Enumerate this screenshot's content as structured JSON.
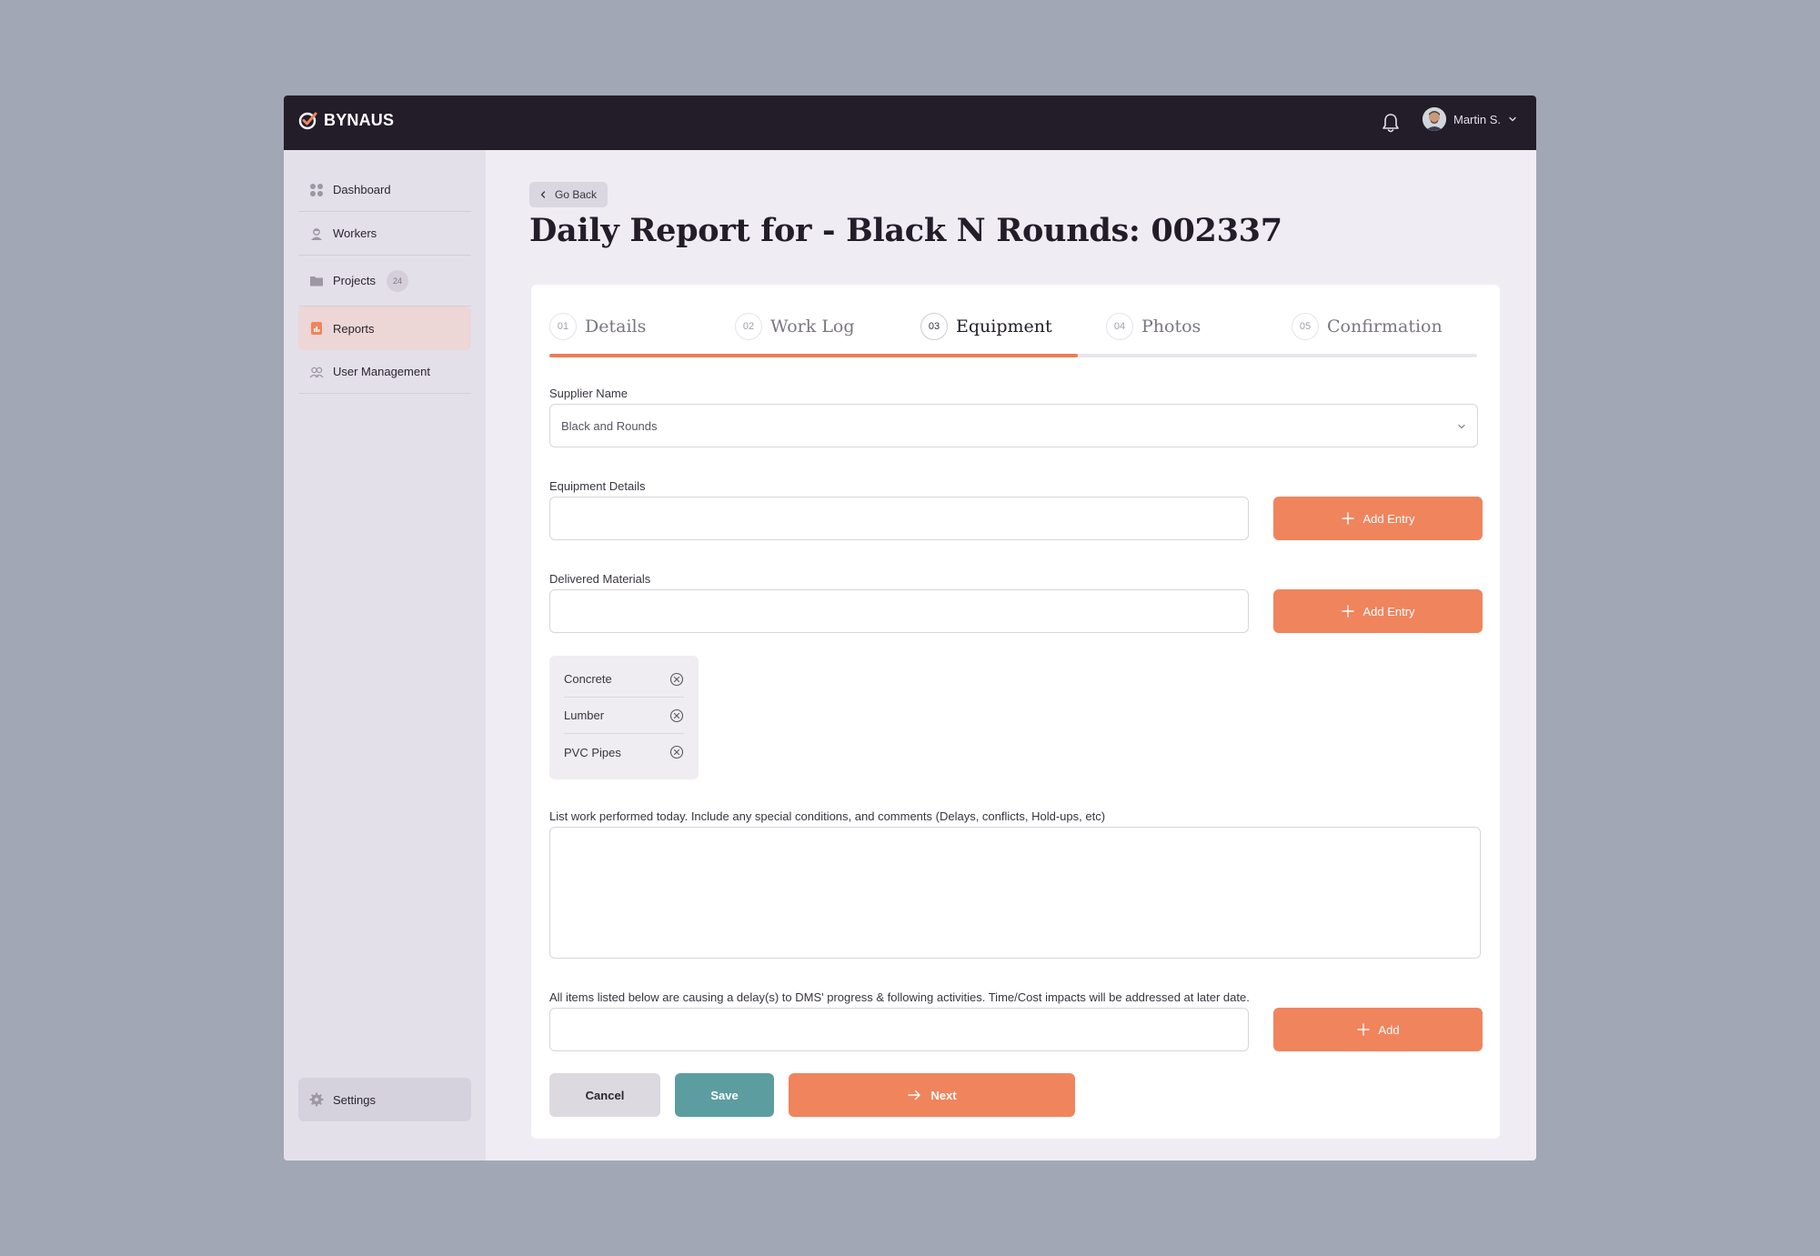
{
  "app": {
    "brand": "BYNAUS",
    "user_name": "Martin S."
  },
  "sidebar": {
    "items": [
      {
        "label": "Dashboard",
        "icon": "grid-icon"
      },
      {
        "label": "Workers",
        "icon": "worker-icon"
      },
      {
        "label": "Projects",
        "icon": "folder-icon",
        "badge": "24"
      },
      {
        "label": "Reports",
        "icon": "report-icon",
        "active": true
      },
      {
        "label": "User Management",
        "icon": "users-icon"
      }
    ],
    "settings_label": "Settings"
  },
  "header": {
    "back_label": "Go Back",
    "title": "Daily Report for - Black N Rounds: 002337"
  },
  "steps": [
    {
      "num": "01",
      "label": "Details"
    },
    {
      "num": "02",
      "label": "Work Log"
    },
    {
      "num": "03",
      "label": "Equipment",
      "active": true
    },
    {
      "num": "04",
      "label": "Photos"
    },
    {
      "num": "05",
      "label": "Confirmation"
    }
  ],
  "progress": 0.57,
  "form": {
    "supplier_label": "Supplier Name",
    "supplier_value": "Black and Rounds",
    "equipment_label": "Equipment Details",
    "equipment_value": "",
    "materials_label": "Delivered Materials",
    "materials_value": "",
    "add_entry_label": "Add Entry",
    "materials": [
      "Concrete",
      "Lumber",
      "PVC Pipes"
    ],
    "work_label": "List work performed today. Include any special conditions, and comments (Delays, conflicts, Hold-ups, etc)",
    "work_value": "",
    "delay_label": "All items listed below are causing a delay(s) to DMS' progress & following activities. Time/Cost impacts will be addressed at later date.",
    "delay_value": "",
    "add_label": "Add"
  },
  "actions": {
    "cancel": "Cancel",
    "save": "Save",
    "next": "Next"
  },
  "colors": {
    "accent": "#f0845d",
    "save": "#5c9e9f",
    "topbar": "#221d29",
    "sidebar_active": "#ecd6d6"
  }
}
